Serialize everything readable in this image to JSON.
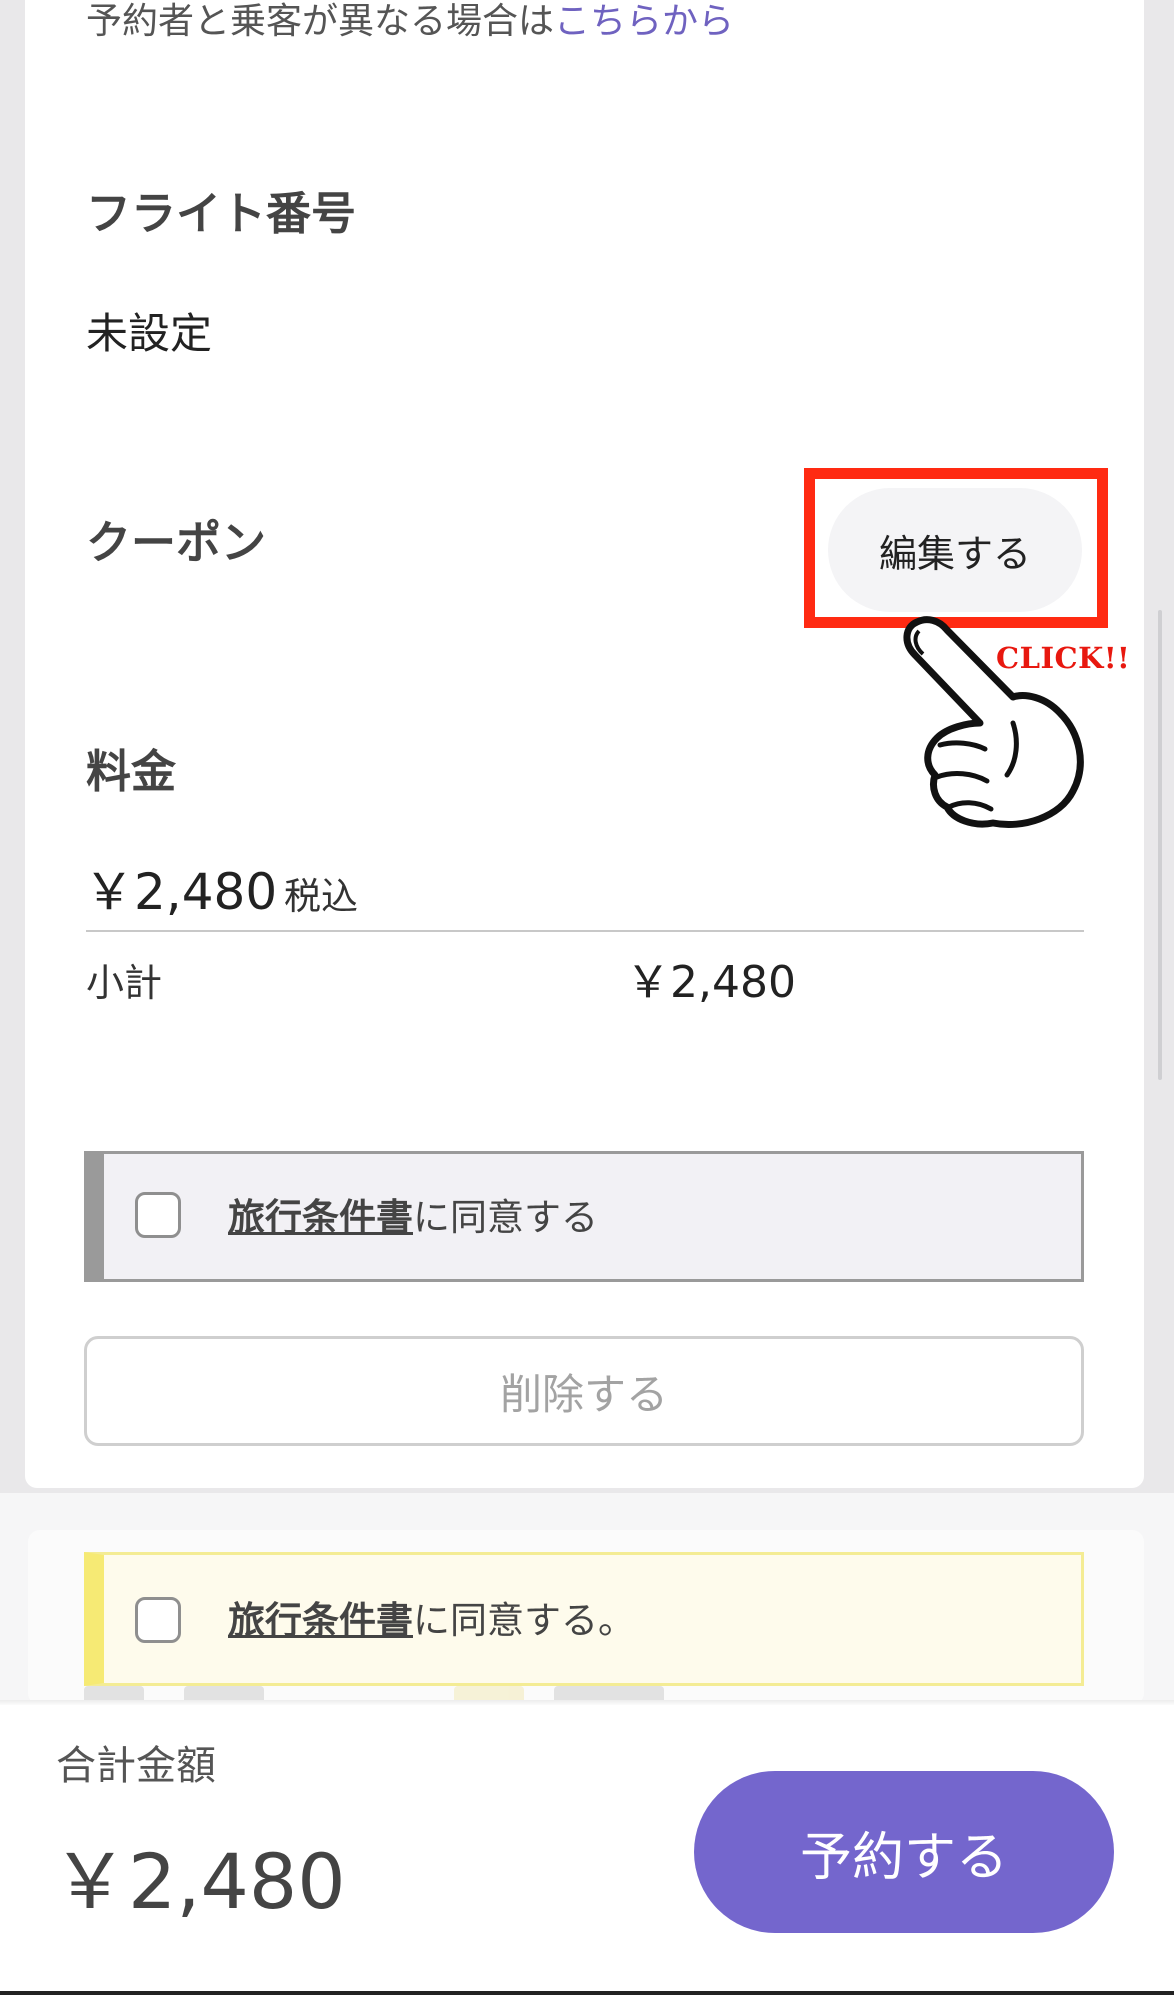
{
  "booker": {
    "prefix": "予約者と乗客が異なる場合は",
    "link": "こちらから"
  },
  "flight": {
    "title": "フライト番号",
    "value": "未設定"
  },
  "coupon": {
    "title": "クーポン",
    "edit_label": "編集する"
  },
  "annotation": {
    "click_text": "CLICK!!",
    "highlight_color": "#ff2a12"
  },
  "fee": {
    "title": "料金",
    "price": "￥2,480",
    "tax_note": "税込",
    "subtotal_label": "小計",
    "subtotal_value": "￥2,480"
  },
  "agreement": {
    "terms_link": "旅行条件書",
    "text": "に同意する",
    "checked": false
  },
  "delete_label": "削除する",
  "agreement_footer": {
    "terms_link": "旅行条件書",
    "text": "に同意する。",
    "checked": false
  },
  "summary": {
    "total_label": "合計金額",
    "total_value": "￥2,480",
    "reserve_label": "予約する",
    "accent_color": "#7466cd"
  }
}
